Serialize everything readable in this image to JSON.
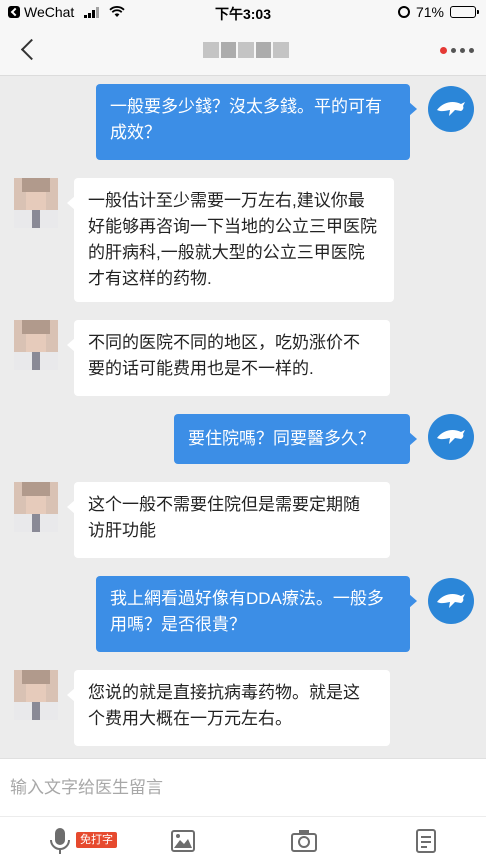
{
  "status_bar": {
    "app": "WeChat",
    "time": "下午3:03",
    "battery": "71%",
    "battery_level": 0.71
  },
  "nav": {
    "title": ""
  },
  "messages": [
    {
      "from": "me",
      "text": "一般要多少錢？沒太多錢。平的可有成效？"
    },
    {
      "from": "doctor",
      "text": "一般估计至少需要一万左右,建议你最好能够再咨询一下当地的公立三甲医院的肝病科,一般就大型的公立三甲医院才有这样的药物."
    },
    {
      "from": "doctor",
      "text": "不同的医院不同的地区，吃奶涨价不要的话可能费用也是不一样的."
    },
    {
      "from": "me",
      "text": "要住院嗎？同要醫多久？"
    },
    {
      "from": "doctor",
      "text": "这个一般不需要住院但是需要定期随访肝功能"
    },
    {
      "from": "me",
      "text": "我上網看過好像有DDA療法。一般多用嗎？是否很貴？"
    },
    {
      "from": "doctor",
      "text": "您说的就是直接抗病毒药物。就是这个费用大概在一万元左右。"
    }
  ],
  "input": {
    "placeholder": "输入文字给医生留言",
    "value": ""
  },
  "toolbar": {
    "voice_badge": "免打字",
    "icons": [
      "microphone-icon",
      "image-icon",
      "camera-icon",
      "notes-icon"
    ]
  },
  "colors": {
    "my_bubble": "#3c8ee6",
    "doctor_bubble": "#ffffff",
    "background": "#ececec",
    "accent_red": "#e53935"
  }
}
